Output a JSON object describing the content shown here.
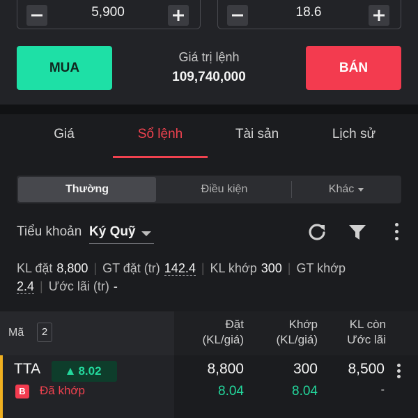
{
  "order_panel": {
    "quantity": "5,900",
    "price": "18.6",
    "buy_label": "MUA",
    "sell_label": "BÁN",
    "order_value_label": "Giá trị lệnh",
    "order_value": "109,740,000",
    "colors": {
      "buy": "#1ee0a6",
      "sell": "#f33b4f"
    }
  },
  "tabs": [
    {
      "label": "Giá"
    },
    {
      "label": "Sổ lệnh",
      "active": true
    },
    {
      "label": "Tài sản"
    },
    {
      "label": "Lịch sử"
    }
  ],
  "segments": [
    {
      "label": "Thường",
      "active": true
    },
    {
      "label": "Điều kiện"
    },
    {
      "label": "Khác"
    }
  ],
  "subaccount": {
    "label": "Tiểu khoản",
    "value": "Ký Quỹ"
  },
  "icons": [
    "refresh-icon",
    "filter-icon",
    "more-vertical-icon"
  ],
  "stats": {
    "kl_dat_label": "KL đặt",
    "kl_dat": "8,800",
    "gt_dat_label": "GT đặt (tr)",
    "gt_dat": "142.4",
    "kl_khop_label": "KL khớp",
    "kl_khop": "300",
    "gt_khop_label": "GT khớp",
    "gt_khop": "2.4",
    "uoc_lai_label": "Ước lãi (tr)",
    "uoc_lai": "-"
  },
  "table": {
    "header": {
      "symbol": "Mã",
      "count": "2",
      "col1_line1": "Đặt",
      "col1_line2": "(KL/giá)",
      "col2_line1": "Khớp",
      "col2_line2": "(KL/giá)",
      "col3_line1": "KL còn",
      "col3_line2": "Ước lãi"
    },
    "rows": [
      {
        "symbol": "TTA",
        "market_price": "8.02",
        "side": "B",
        "status": "Đã khớp",
        "order_qty": "8,800",
        "order_price": "8.04",
        "match_qty": "300",
        "match_price": "8.04",
        "remaining": "8,500",
        "est_profit": "-"
      }
    ]
  },
  "colors": {
    "accent_red": "#f0424f",
    "up_green": "#23d79c",
    "row_accent": "#f0b020"
  }
}
